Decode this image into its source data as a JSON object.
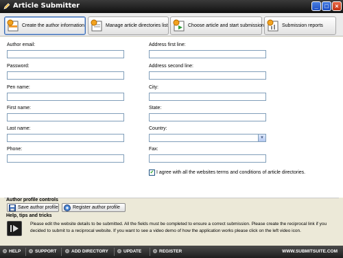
{
  "window": {
    "title": "Article Submitter"
  },
  "navbar": {
    "items": [
      {
        "label": "Create the author information",
        "icon": "author-icon",
        "active": true
      },
      {
        "label": "Manage article directories list",
        "icon": "list-icon",
        "active": false
      },
      {
        "label": "Choose article and start submission",
        "icon": "submit-icon",
        "active": false
      },
      {
        "label": "Submission reports",
        "icon": "report-icon",
        "active": false
      }
    ]
  },
  "form": {
    "left": [
      {
        "label": "Author email:",
        "value": ""
      },
      {
        "label": "Password:",
        "value": ""
      },
      {
        "label": "Pen name:",
        "value": ""
      },
      {
        "label": "First name:",
        "value": ""
      },
      {
        "label": "Last name:",
        "value": ""
      },
      {
        "label": "Phone:",
        "value": ""
      }
    ],
    "right": [
      {
        "label": "Address first line:",
        "value": ""
      },
      {
        "label": "Address second line:",
        "value": ""
      },
      {
        "label": "City:",
        "value": ""
      },
      {
        "label": "State:",
        "value": ""
      },
      {
        "label": "Country:",
        "value": ""
      },
      {
        "label": "Fax:",
        "value": ""
      }
    ],
    "agree_label": "I agree with all the websites terms and conditions of article directories.",
    "agree_checked": true
  },
  "profile": {
    "title": "Author profile controls",
    "save_label": "Save author profile",
    "register_label": "Register author profile"
  },
  "help": {
    "title": "Help, tips and tricks",
    "text": "Please edit the website details to be submitted. All the fields must be completed to ensure a correct submission. Please create the reciprocal link if you decided to submit to a reciprocal website. If you want to see a video demo of how the application works please click on the left video icon."
  },
  "footer": {
    "links": [
      "HELP",
      "SUPPORT",
      "ADD DIRECTORY",
      "UPDATE",
      "REGISTER"
    ],
    "site": "WWW.SUBMITSUITE.COM"
  },
  "colors": {
    "accent": "#3a6ab1",
    "titlebar": "#111111",
    "close": "#c1300e",
    "check": "#21a121"
  }
}
